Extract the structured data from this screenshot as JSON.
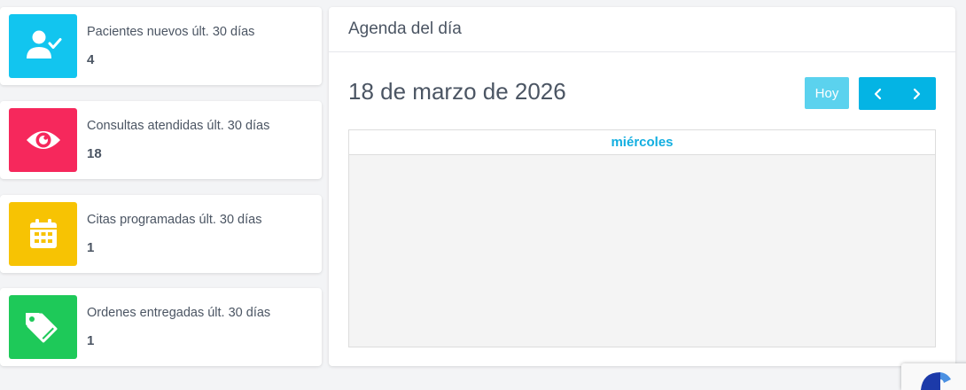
{
  "stats": [
    {
      "label": "Pacientes nuevos últ. 30 días",
      "value": "4",
      "icon": "user-check-icon",
      "color": "#12c5ef"
    },
    {
      "label": "Consultas atendidas últ. 30 días",
      "value": "18",
      "icon": "eye-icon",
      "color": "#f6285c"
    },
    {
      "label": "Citas programadas últ. 30 días",
      "value": "1",
      "icon": "calendar-icon",
      "color": "#f7c303"
    },
    {
      "label": "Ordenes entregadas últ. 30 días",
      "value": "1",
      "icon": "tags-icon",
      "color": "#1ec959"
    }
  ],
  "agenda": {
    "title": "Agenda del día",
    "date": "18 de marzo de 2026",
    "today_button": "Hoy",
    "prev_icon": "chevron-left-icon",
    "next_icon": "chevron-right-icon",
    "day_header": "miércoles"
  },
  "colors": {
    "accent": "#04b4e4",
    "accent_light": "#5bd2ee",
    "day_header": "#12aee0"
  }
}
